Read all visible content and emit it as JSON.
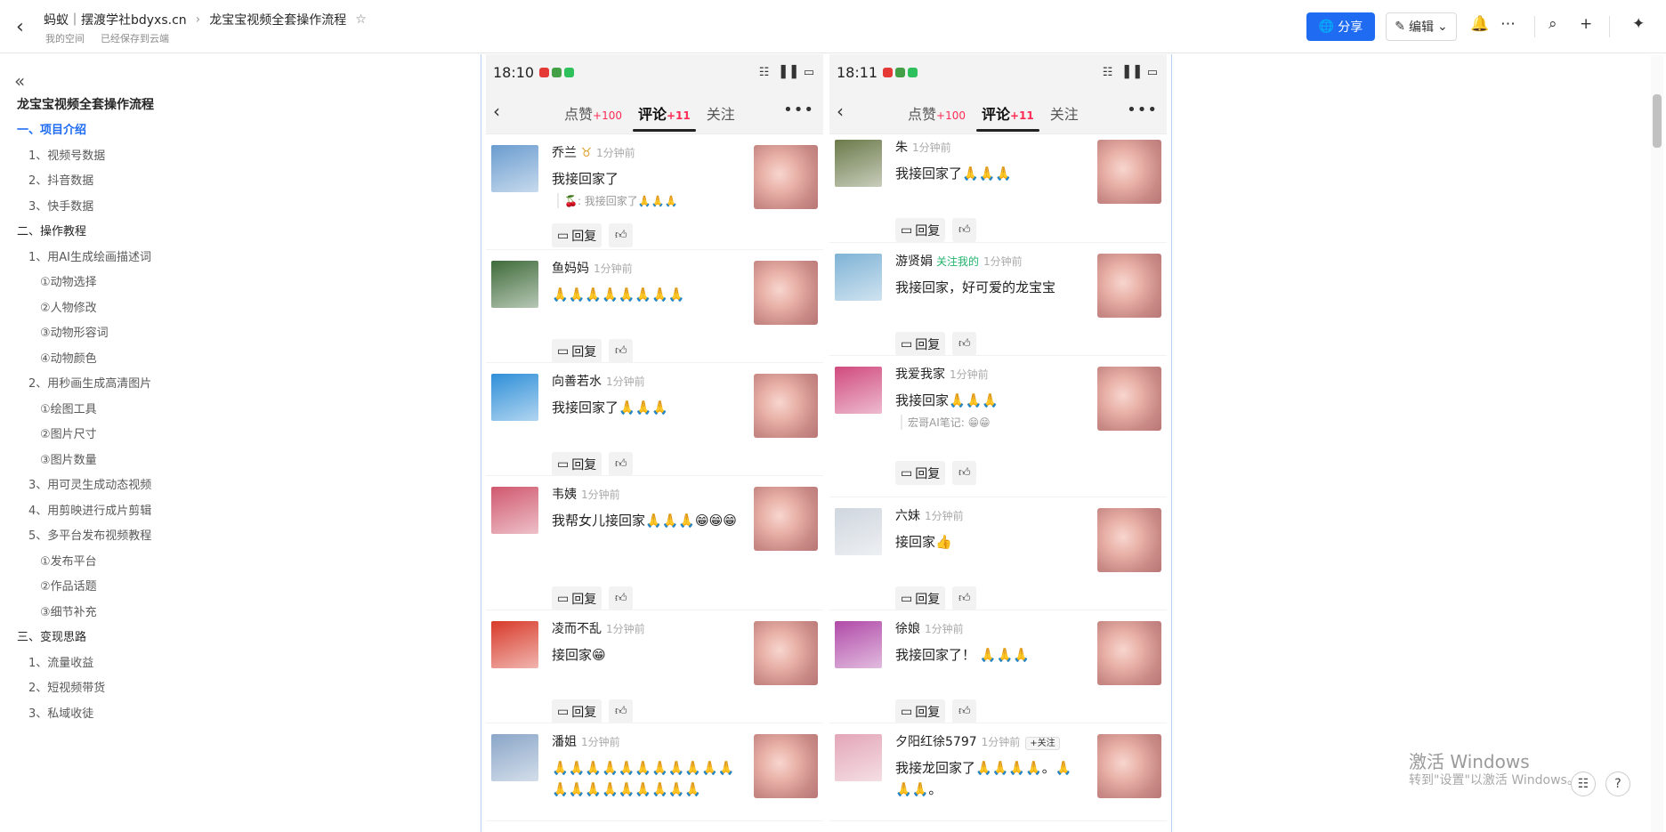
{
  "header": {
    "crumb1": "蚂蚁｜摆渡学社bdyxs.cn",
    "crumb2": "龙宝宝视频全套操作流程",
    "sub1": "我的空间",
    "sub2": "已经保存到云端",
    "share_label": "分享",
    "edit_label": "编辑"
  },
  "sidebar": {
    "title": "龙宝宝视频全套操作流程",
    "items": [
      {
        "label": "一、项目介绍",
        "level": 0,
        "active": true
      },
      {
        "label": "1、视频号数据",
        "level": 1
      },
      {
        "label": "2、抖音数据",
        "level": 1
      },
      {
        "label": "3、快手数据",
        "level": 1
      },
      {
        "label": "二、操作教程",
        "level": 0
      },
      {
        "label": "1、用AI生成绘画描述词",
        "level": 1
      },
      {
        "label": "①动物选择",
        "level": 2
      },
      {
        "label": "②人物修改",
        "level": 2
      },
      {
        "label": "③动物形容词",
        "level": 2
      },
      {
        "label": "④动物颜色",
        "level": 2
      },
      {
        "label": "2、用秒画生成高清图片",
        "level": 1
      },
      {
        "label": "①绘图工具",
        "level": 2
      },
      {
        "label": "②图片尺寸",
        "level": 2
      },
      {
        "label": "③图片数量",
        "level": 2
      },
      {
        "label": "3、用可灵生成动态视频",
        "level": 1
      },
      {
        "label": "4、用剪映进行成片剪辑",
        "level": 1
      },
      {
        "label": "5、多平台发布视频教程",
        "level": 1
      },
      {
        "label": "①发布平台",
        "level": 2
      },
      {
        "label": "②作品话题",
        "level": 2
      },
      {
        "label": "③细节补充",
        "level": 2
      },
      {
        "label": "三、变现思路",
        "level": 0
      },
      {
        "label": "1、流量收益",
        "level": 1
      },
      {
        "label": "2、短视频带货",
        "level": 1
      },
      {
        "label": "3、私域收徒",
        "level": 1
      }
    ]
  },
  "phones": [
    {
      "time": "18:10",
      "tabs": [
        {
          "label": "点赞",
          "count": "+100"
        },
        {
          "label": "评论",
          "count": "+11"
        },
        {
          "label": "关注",
          "count": ""
        }
      ],
      "reply_label": "回复",
      "comments": [
        {
          "name": "乔兰",
          "badge": "♉",
          "time": "1分钟前",
          "text": "我接回家了",
          "reply": "🍒: 我接回家了🙏🙏🙏",
          "h": 130,
          "av": "#6a9ccf"
        },
        {
          "name": "鱼妈妈",
          "time": "1分钟前",
          "text": "🙏🙏🙏🙏🙏🙏🙏🙏",
          "h": 127,
          "av": "#3f6b3a"
        },
        {
          "name": "向善若水",
          "time": "1分钟前",
          "text": "我接回家了🙏🙏🙏",
          "h": 127,
          "av": "#2f8fd8"
        },
        {
          "name": "韦姨",
          "time": "1分钟前",
          "text": "我帮女儿接回家🙏🙏🙏😁😁😁",
          "h": 151,
          "av": "#d0586e"
        },
        {
          "name": "凌而不乱",
          "time": "1分钟前",
          "text": "接回家😁",
          "h": 127,
          "av": "#d83a2a"
        },
        {
          "name": "潘姐",
          "time": "1分钟前",
          "text": "🙏🙏🙏🙏🙏🙏🙏🙏🙏🙏🙏🙏🙏🙏🙏🙏🙏🙏🙏🙏",
          "h": 110,
          "av": "#8aa6c8"
        }
      ]
    },
    {
      "time": "18:11",
      "tabs": [
        {
          "label": "点赞",
          "count": "+100"
        },
        {
          "label": "评论",
          "count": "+11"
        },
        {
          "label": "关注",
          "count": ""
        }
      ],
      "reply_label": "回复",
      "comments": [
        {
          "name": "朱",
          "time": "1分钟前",
          "text": "我接回家了🙏🙏🙏",
          "h": 122,
          "av": "#6b7a4a"
        },
        {
          "name": "游贤娟",
          "follow": "关注我的",
          "time": "1分钟前",
          "text": "我接回家，好可爱的龙宝宝",
          "h": 127,
          "av": "#7fb3d6"
        },
        {
          "name": "我爱我家",
          "time": "1分钟前",
          "text": "我接回家🙏🙏🙏",
          "reply": "宏哥AI笔记: 😁😁",
          "h": 159,
          "av": "#d04a7e"
        },
        {
          "name": "六妹",
          "time": "1分钟前",
          "text": "接回家👍",
          "h": 127,
          "av": "#cfd6de"
        },
        {
          "name": "徐娘",
          "time": "1分钟前",
          "text": "我接回家了！ 🙏🙏🙏",
          "h": 127,
          "av": "#b04aa8"
        },
        {
          "name": "夕阳红徐5797",
          "time": "1分钟前",
          "follow_btn": "+关注",
          "text": "我接龙回家了🙏🙏🙏🙏。🙏🙏🙏。",
          "h": 110,
          "av": "#e3a6b8"
        }
      ]
    }
  ],
  "watermark": {
    "line1": "激活 Windows",
    "line2": "转到\"设置\"以激活 Windows。"
  }
}
